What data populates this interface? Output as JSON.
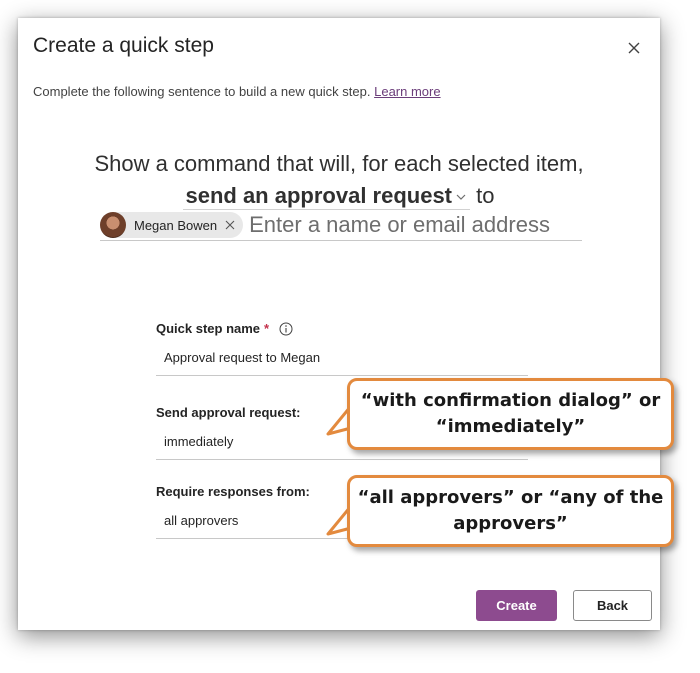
{
  "dialog": {
    "title": "Create a quick step",
    "subtitle": "Complete the following sentence to build a new quick step.",
    "learn_more": "Learn more"
  },
  "sentence": {
    "line1": "Show a command that will, for each selected item,",
    "command": "send an approval request",
    "to": "to",
    "recipient_name": "Megan Bowen",
    "recipient_placeholder": "Enter a name or email address"
  },
  "fields": {
    "name_label": "Quick step name",
    "name_required": "*",
    "name_value": "Approval request to Megan",
    "send_label": "Send approval request:",
    "send_value": "immediately",
    "require_label": "Require responses from:",
    "require_value": "all approvers"
  },
  "buttons": {
    "create": "Create",
    "back": "Back"
  },
  "callouts": {
    "send_note": "“with confirmation dialog” or “immediately”",
    "require_note": "“all approvers” or “any of the approvers”"
  },
  "colors": {
    "accent": "#8d4b8f",
    "callout_border": "#e38a3e",
    "link": "#6b3d7a",
    "required": "#c4314b"
  }
}
